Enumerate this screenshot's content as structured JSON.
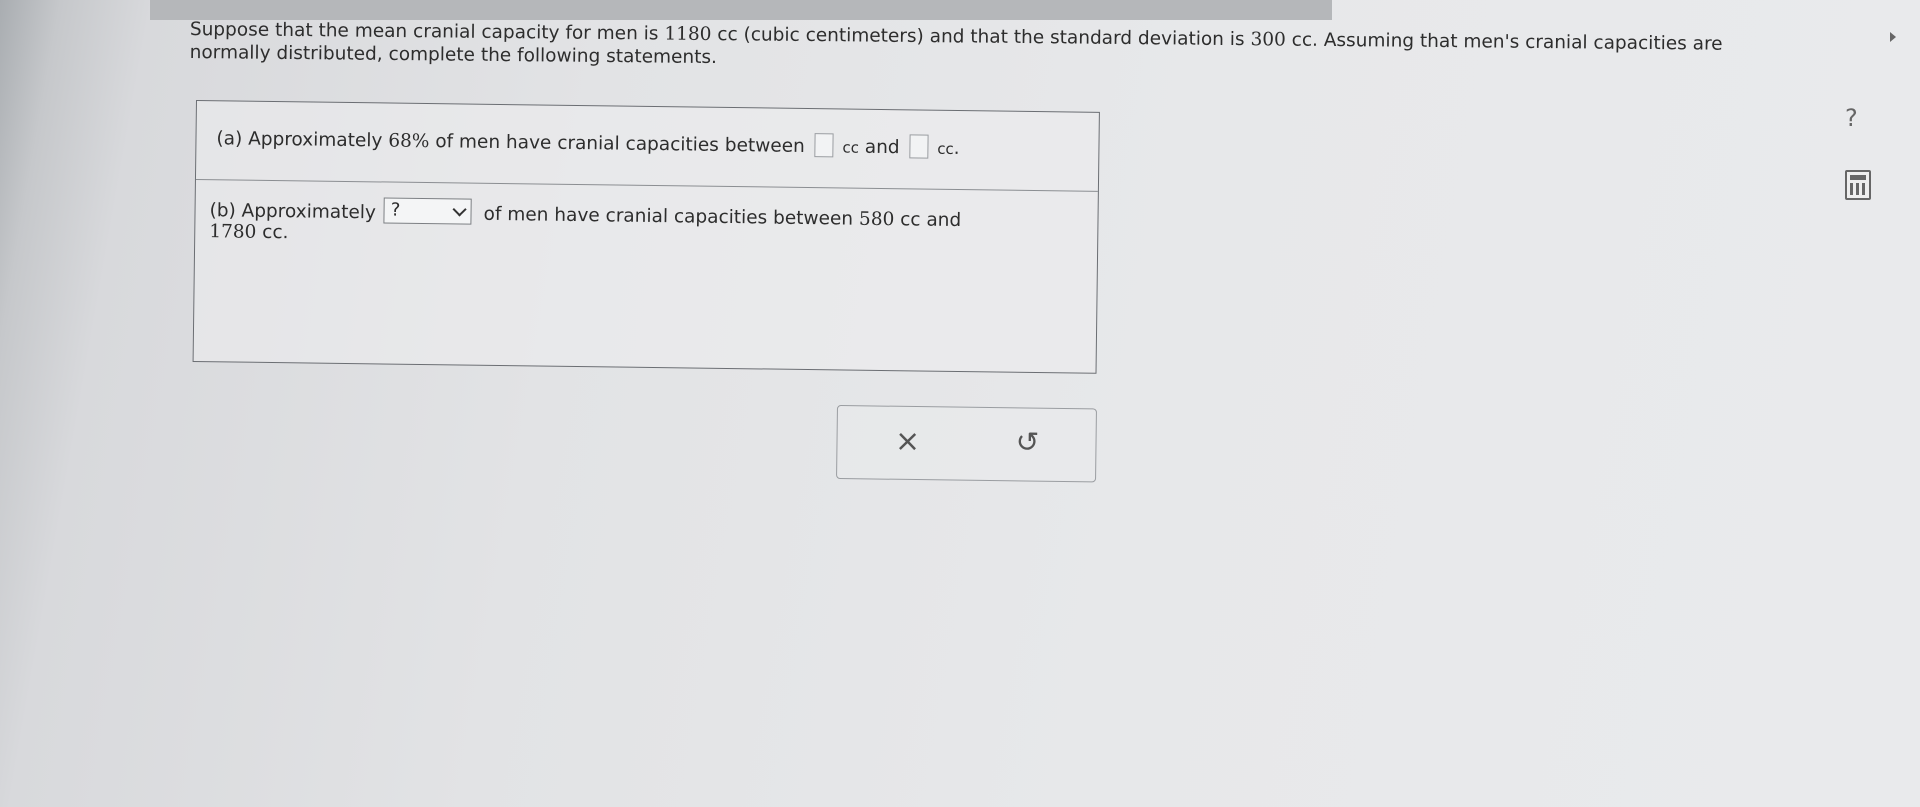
{
  "question": {
    "part1": "Suppose that the mean cranial capacity for men is ",
    "mean": "1180",
    "part2": " cc (cubic centimeters) and that the standard deviation is ",
    "sd": "300",
    "part3": " cc. Assuming that men's cranial capacities are normally distributed, complete the following statements."
  },
  "part_a": {
    "prefix": "(a) Approximately ",
    "percent": "68%",
    "middle": " of men have cranial capacities between ",
    "unit1": " cc",
    "and": " and ",
    "unit2": " cc",
    "end": "."
  },
  "part_b": {
    "prefix": "(b) Approximately ",
    "select_value": "?",
    "middle": " of men have cranial capacities between ",
    "low": "580",
    "middle2": " cc and",
    "high": "1780",
    "end": " cc."
  },
  "actions": {
    "clear_symbol": "×",
    "undo_symbol": "↺"
  },
  "icons": {
    "help": "?"
  }
}
